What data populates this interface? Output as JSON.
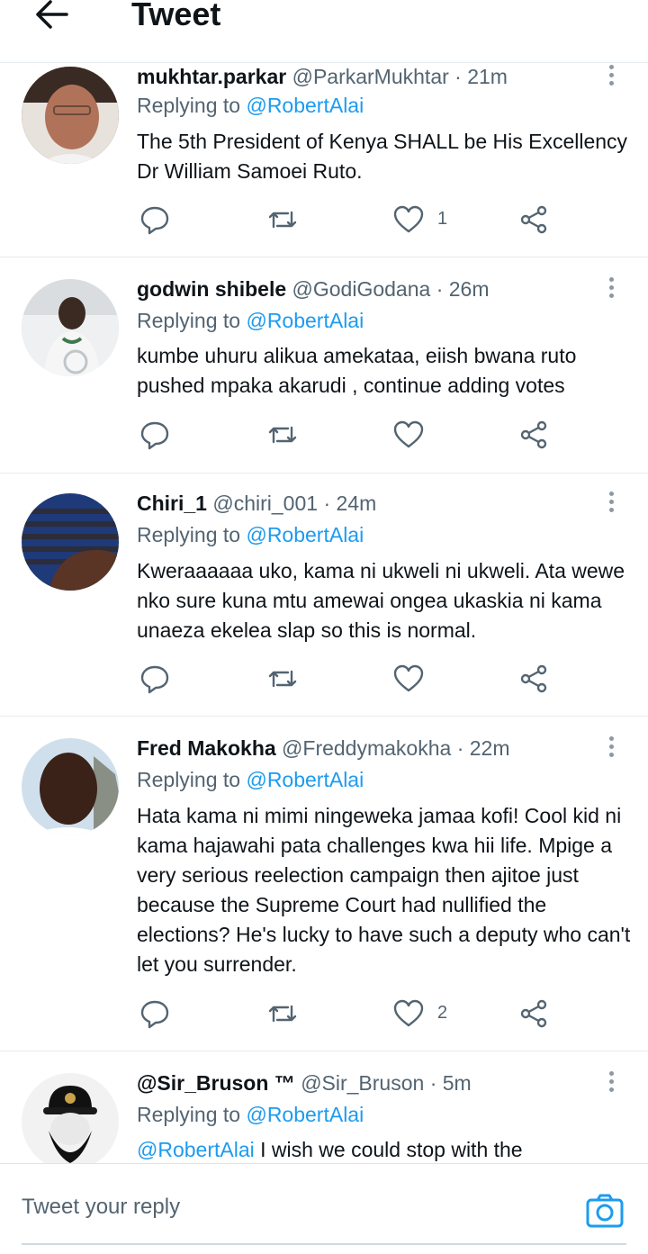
{
  "header": {
    "title": "Tweet"
  },
  "tweets": [
    {
      "name": "mukhtar.parkar",
      "handle": "@ParkarMukhtar",
      "time": "· 21m",
      "replying_prefix": "Replying to",
      "replying_to": "@RobertAlai",
      "text": "The 5th President of Kenya SHALL be His Excellency Dr William Samoei Ruto.",
      "likes": "1"
    },
    {
      "name": "godwin shibele",
      "handle": "@GodiGodana",
      "time": "· 26m",
      "replying_prefix": "Replying to",
      "replying_to": "@RobertAlai",
      "text": "kumbe uhuru alikua amekataa, eiish bwana ruto pushed mpaka akarudi , continue adding votes",
      "likes": ""
    },
    {
      "name": "Chiri_1",
      "handle": "@chiri_001",
      "time": "· 24m",
      "replying_prefix": "Replying to",
      "replying_to": "@RobertAlai",
      "text": "Kweraaaaaa uko, kama ni ukweli ni ukweli. Ata wewe nko sure kuna mtu amewai ongea ukaskia ni kama unaeza ekelea slap so this is normal.",
      "likes": ""
    },
    {
      "name": "Fred Makokha",
      "handle": "@Freddymakokha",
      "time": "· 22m",
      "replying_prefix": "Replying to",
      "replying_to": "@RobertAlai",
      "text": "Hata kama ni mimi ningeweka jamaa kofi! Cool kid ni kama hajawahi pata challenges kwa hii life. Mpige a very serious reelection campaign then ajitoe just because the Supreme Court had nullified the elections? He's lucky to have such a deputy who can't let you surrender.",
      "likes": "2"
    },
    {
      "name": "@Sir_Bruson ™",
      "handle": "@Sir_Bruson",
      "time": "· 5m",
      "replying_prefix": "Replying to",
      "replying_to": "@RobertAlai",
      "mention": "@RobertAlai",
      "text": " I wish we could stop with the",
      "likes": ""
    }
  ],
  "reply_bar": {
    "placeholder": "Tweet your reply"
  },
  "colors": {
    "link": "#1d9bf0",
    "secondary_text": "#536471",
    "divider": "#e6ecf0"
  },
  "icons": [
    "back-arrow-icon",
    "more-icon",
    "reply-icon",
    "retweet-icon",
    "like-icon",
    "share-icon",
    "camera-icon"
  ]
}
